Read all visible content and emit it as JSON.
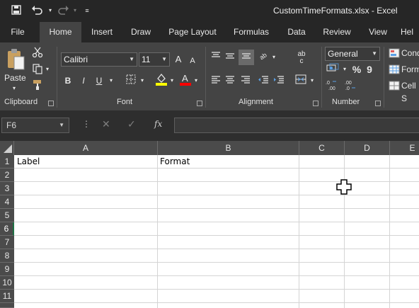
{
  "window": {
    "title": "CustomTimeFormats.xlsx  -  Excel"
  },
  "quick_access": [
    "save-icon",
    "undo-icon",
    "redo-icon",
    "customize-icon"
  ],
  "tabs": [
    {
      "label": "File"
    },
    {
      "label": "Home"
    },
    {
      "label": "Insert"
    },
    {
      "label": "Draw"
    },
    {
      "label": "Page Layout"
    },
    {
      "label": "Formulas"
    },
    {
      "label": "Data"
    },
    {
      "label": "Review"
    },
    {
      "label": "View"
    },
    {
      "label": "Hel"
    }
  ],
  "active_tab": "Home",
  "ribbon": {
    "clipboard": {
      "label": "Clipboard",
      "paste": "Paste"
    },
    "font": {
      "label": "Font",
      "name": "Calibri",
      "size": "11",
      "grow": "A",
      "shrink": "A",
      "bold": "B",
      "italic": "I",
      "underline": "U",
      "fill_color": "#ffff00",
      "font_color": "#ff0000"
    },
    "alignment": {
      "label": "Alignment",
      "wrap": "ab\nc"
    },
    "number": {
      "label": "Number",
      "format": "General",
      "percent": "%",
      "comma": "9"
    },
    "styles": {
      "conditional": "Cond",
      "format_table": "Form",
      "cell_styles": "Cell S"
    }
  },
  "formula_bar": {
    "name_box": "F6",
    "cancel": "✕",
    "enter": "✓",
    "fx": "fx",
    "value": ""
  },
  "grid": {
    "columns": [
      "A",
      "B",
      "C",
      "D",
      "E"
    ],
    "rows": [
      "1",
      "2",
      "3",
      "4",
      "5",
      "6",
      "7",
      "8",
      "9",
      "10",
      "11"
    ],
    "selected_row": "6",
    "cells": {
      "A1": "Label",
      "B1": "Format"
    }
  }
}
